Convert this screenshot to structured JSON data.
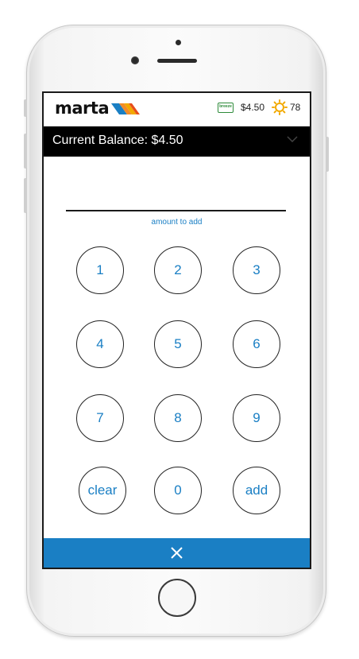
{
  "header": {
    "logo_text": "marta",
    "breeze_badge": "breeze",
    "breeze_amount": "$4.50",
    "weather_icon": "sun-icon",
    "temperature": "78"
  },
  "balance": {
    "label": "Current Balance: $4.50",
    "chevron_icon": "chevron-down-icon"
  },
  "amount": {
    "value": "",
    "caption": "amount to add"
  },
  "keypad": {
    "keys": [
      "1",
      "2",
      "3",
      "4",
      "5",
      "6",
      "7",
      "8",
      "9",
      "clear",
      "0",
      "add"
    ]
  },
  "footer": {
    "close_icon": "close-icon"
  },
  "colors": {
    "accent": "#1a7fc4",
    "balance_bar": "#000000",
    "breeze_green": "#2e8b3a",
    "sun_orange": "#f2a900",
    "logo_orange": "#f28c28",
    "logo_blue": "#1a7fc4"
  }
}
